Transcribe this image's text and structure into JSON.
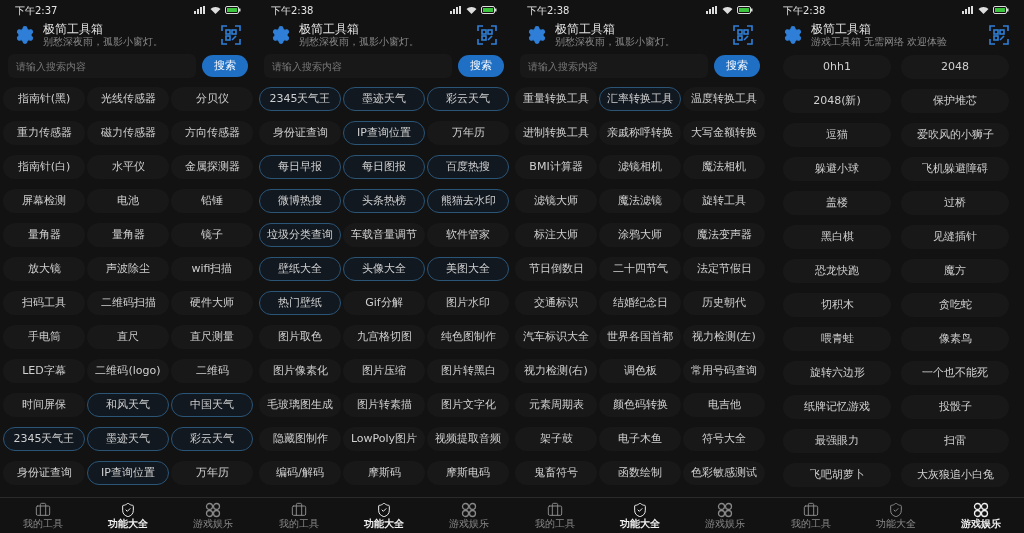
{
  "panels": [
    {
      "time": "下午2:37",
      "title": "极简工具箱",
      "subtitle": "别愁深夜雨，孤影小窗灯。",
      "search": {
        "placeholder": "请输入搜索内容",
        "button": "搜索"
      },
      "kind": "tools",
      "items": [
        {
          "label": "指南针(黑)",
          "highlighted": false
        },
        {
          "label": "光线传感器",
          "highlighted": false
        },
        {
          "label": "分贝仪",
          "highlighted": false
        },
        {
          "label": "重力传感器",
          "highlighted": false
        },
        {
          "label": "磁力传感器",
          "highlighted": false
        },
        {
          "label": "方向传感器",
          "highlighted": false
        },
        {
          "label": "指南针(白)",
          "highlighted": false
        },
        {
          "label": "水平仪",
          "highlighted": false
        },
        {
          "label": "金属探测器",
          "highlighted": false
        },
        {
          "label": "屏幕检测",
          "highlighted": false
        },
        {
          "label": "电池",
          "highlighted": false
        },
        {
          "label": "铅锤",
          "highlighted": false
        },
        {
          "label": "量角器",
          "highlighted": false
        },
        {
          "label": "量角器",
          "highlighted": false
        },
        {
          "label": "镜子",
          "highlighted": false
        },
        {
          "label": "放大镜",
          "highlighted": false
        },
        {
          "label": "声波除尘",
          "highlighted": false
        },
        {
          "label": "wifi扫描",
          "highlighted": false
        },
        {
          "label": "扫码工具",
          "highlighted": false
        },
        {
          "label": "二维码扫描",
          "highlighted": false
        },
        {
          "label": "硬件大师",
          "highlighted": false
        },
        {
          "label": "手电筒",
          "highlighted": false
        },
        {
          "label": "直尺",
          "highlighted": false
        },
        {
          "label": "直尺测量",
          "highlighted": false
        },
        {
          "label": "LED字幕",
          "highlighted": false
        },
        {
          "label": "二维码(logo)",
          "highlighted": false
        },
        {
          "label": "二维码",
          "highlighted": false
        },
        {
          "label": "时间屏保",
          "highlighted": false
        },
        {
          "label": "和风天气",
          "highlighted": true
        },
        {
          "label": "中国天气",
          "highlighted": true
        },
        {
          "label": "2345天气王",
          "highlighted": true
        },
        {
          "label": "墨迹天气",
          "highlighted": true
        },
        {
          "label": "彩云天气",
          "highlighted": true
        },
        {
          "label": "身份证查询",
          "highlighted": false
        },
        {
          "label": "IP查询位置",
          "highlighted": true
        },
        {
          "label": "万年历",
          "highlighted": false
        }
      ],
      "tabs": [
        {
          "label": "我的工具",
          "kind": "tools",
          "selected": false
        },
        {
          "label": "功能大全",
          "kind": "features",
          "selected": true
        },
        {
          "label": "游戏娱乐",
          "kind": "games",
          "selected": false
        }
      ]
    },
    {
      "time": "下午2:38",
      "title": "极简工具箱",
      "subtitle": "别愁深夜雨，孤影小窗灯。",
      "search": {
        "placeholder": "请输入搜索内容",
        "button": "搜索"
      },
      "kind": "tools",
      "items": [
        {
          "label": "2345天气王",
          "highlighted": true
        },
        {
          "label": "墨迹天气",
          "highlighted": true
        },
        {
          "label": "彩云天气",
          "highlighted": true
        },
        {
          "label": "身份证查询",
          "highlighted": false
        },
        {
          "label": "IP查询位置",
          "highlighted": true
        },
        {
          "label": "万年历",
          "highlighted": false
        },
        {
          "label": "每日早报",
          "highlighted": true
        },
        {
          "label": "每日图报",
          "highlighted": true
        },
        {
          "label": "百度热搜",
          "highlighted": true
        },
        {
          "label": "微博热搜",
          "highlighted": true
        },
        {
          "label": "头条热榜",
          "highlighted": true
        },
        {
          "label": "熊猫去水印",
          "highlighted": true
        },
        {
          "label": "垃圾分类查询",
          "highlighted": true
        },
        {
          "label": "车载音量调节",
          "highlighted": false
        },
        {
          "label": "软件管家",
          "highlighted": false
        },
        {
          "label": "壁纸大全",
          "highlighted": true
        },
        {
          "label": "头像大全",
          "highlighted": true
        },
        {
          "label": "美图大全",
          "highlighted": true
        },
        {
          "label": "热门壁纸",
          "highlighted": true
        },
        {
          "label": "Gif分解",
          "highlighted": false
        },
        {
          "label": "图片水印",
          "highlighted": false
        },
        {
          "label": "图片取色",
          "highlighted": false
        },
        {
          "label": "九宫格切图",
          "highlighted": false
        },
        {
          "label": "纯色图制作",
          "highlighted": false
        },
        {
          "label": "图片像素化",
          "highlighted": false
        },
        {
          "label": "图片压缩",
          "highlighted": false
        },
        {
          "label": "图片转黑白",
          "highlighted": false
        },
        {
          "label": "毛玻璃图生成",
          "highlighted": false
        },
        {
          "label": "图片转素描",
          "highlighted": false
        },
        {
          "label": "图片文字化",
          "highlighted": false
        },
        {
          "label": "隐藏图制作",
          "highlighted": false
        },
        {
          "label": "LowPoly图片",
          "highlighted": false
        },
        {
          "label": "视频提取音频",
          "highlighted": false
        },
        {
          "label": "编码/解码",
          "highlighted": false
        },
        {
          "label": "摩斯码",
          "highlighted": false
        },
        {
          "label": "摩斯电码",
          "highlighted": false
        }
      ],
      "tabs": [
        {
          "label": "我的工具",
          "kind": "tools",
          "selected": false
        },
        {
          "label": "功能大全",
          "kind": "features",
          "selected": true
        },
        {
          "label": "游戏娱乐",
          "kind": "games",
          "selected": false
        }
      ]
    },
    {
      "time": "下午2:38",
      "title": "极简工具箱",
      "subtitle": "别愁深夜雨，孤影小窗灯。",
      "search": {
        "placeholder": "请输入搜索内容",
        "button": "搜索"
      },
      "kind": "tools",
      "items": [
        {
          "label": "重量转换工具",
          "highlighted": false
        },
        {
          "label": "汇率转换工具",
          "highlighted": true
        },
        {
          "label": "温度转换工具",
          "highlighted": false
        },
        {
          "label": "进制转换工具",
          "highlighted": false
        },
        {
          "label": "亲戚称呼转换",
          "highlighted": false
        },
        {
          "label": "大写金额转换",
          "highlighted": false
        },
        {
          "label": "BMI计算器",
          "highlighted": false
        },
        {
          "label": "滤镜相机",
          "highlighted": false
        },
        {
          "label": "魔法相机",
          "highlighted": false
        },
        {
          "label": "滤镜大师",
          "highlighted": false
        },
        {
          "label": "魔法滤镜",
          "highlighted": false
        },
        {
          "label": "旋转工具",
          "highlighted": false
        },
        {
          "label": "标注大师",
          "highlighted": false
        },
        {
          "label": "涂鸦大师",
          "highlighted": false
        },
        {
          "label": "魔法变声器",
          "highlighted": false
        },
        {
          "label": "节日倒数日",
          "highlighted": false
        },
        {
          "label": "二十四节气",
          "highlighted": false
        },
        {
          "label": "法定节假日",
          "highlighted": false
        },
        {
          "label": "交通标识",
          "highlighted": false
        },
        {
          "label": "结婚纪念日",
          "highlighted": false
        },
        {
          "label": "历史朝代",
          "highlighted": false
        },
        {
          "label": "汽车标识大全",
          "highlighted": false
        },
        {
          "label": "世界各国首都",
          "highlighted": false
        },
        {
          "label": "视力检测(左)",
          "highlighted": false
        },
        {
          "label": "视力检测(右)",
          "highlighted": false
        },
        {
          "label": "调色板",
          "highlighted": false
        },
        {
          "label": "常用号码查询",
          "highlighted": false
        },
        {
          "label": "元素周期表",
          "highlighted": false
        },
        {
          "label": "颜色码转换",
          "highlighted": false
        },
        {
          "label": "电吉他",
          "highlighted": false
        },
        {
          "label": "架子鼓",
          "highlighted": false
        },
        {
          "label": "电子木鱼",
          "highlighted": false
        },
        {
          "label": "符号大全",
          "highlighted": false
        },
        {
          "label": "鬼畜符号",
          "highlighted": false
        },
        {
          "label": "函数绘制",
          "highlighted": false
        },
        {
          "label": "色彩敏感测试",
          "highlighted": false
        }
      ],
      "tabs": [
        {
          "label": "我的工具",
          "kind": "tools",
          "selected": false
        },
        {
          "label": "功能大全",
          "kind": "features",
          "selected": true
        },
        {
          "label": "游戏娱乐",
          "kind": "games",
          "selected": false
        }
      ]
    },
    {
      "time": "下午2:38",
      "title": "极简工具箱",
      "subtitle": "游戏工具箱 无需网络 欢迎体验",
      "kind": "games",
      "items": [
        {
          "label": "0hh1",
          "highlighted": false
        },
        {
          "label": "2048",
          "highlighted": false
        },
        {
          "label": "2048(新)",
          "highlighted": false
        },
        {
          "label": "保护堆芯",
          "highlighted": false
        },
        {
          "label": "逗猫",
          "highlighted": false
        },
        {
          "label": "爱吹风的小狮子",
          "highlighted": false
        },
        {
          "label": "躲避小球",
          "highlighted": false
        },
        {
          "label": "飞机躲避障碍",
          "highlighted": false
        },
        {
          "label": "盖楼",
          "highlighted": false
        },
        {
          "label": "过桥",
          "highlighted": false
        },
        {
          "label": "黑白棋",
          "highlighted": false
        },
        {
          "label": "见缝插针",
          "highlighted": false
        },
        {
          "label": "恐龙快跑",
          "highlighted": false
        },
        {
          "label": "魔方",
          "highlighted": false
        },
        {
          "label": "切积木",
          "highlighted": false
        },
        {
          "label": "贪吃蛇",
          "highlighted": false
        },
        {
          "label": "喂青蛙",
          "highlighted": false
        },
        {
          "label": "像素鸟",
          "highlighted": false
        },
        {
          "label": "旋转六边形",
          "highlighted": false
        },
        {
          "label": "一个也不能死",
          "highlighted": false
        },
        {
          "label": "纸牌记忆游戏",
          "highlighted": false
        },
        {
          "label": "投骰子",
          "highlighted": false
        },
        {
          "label": "最强眼力",
          "highlighted": false
        },
        {
          "label": "扫雷",
          "highlighted": false
        },
        {
          "label": "飞吧胡萝卜",
          "highlighted": false
        },
        {
          "label": "大灰狼追小白兔",
          "highlighted": false
        }
      ],
      "tabs": [
        {
          "label": "我的工具",
          "kind": "tools",
          "selected": false
        },
        {
          "label": "功能大全",
          "kind": "features",
          "selected": false
        },
        {
          "label": "游戏娱乐",
          "kind": "games",
          "selected": true
        }
      ]
    }
  ]
}
